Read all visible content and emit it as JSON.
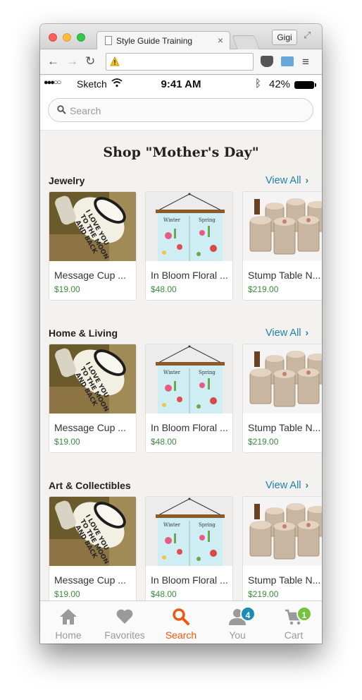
{
  "browser": {
    "tab_title": "Style Guide Training",
    "tab_close": "×",
    "profile_name": "Gigi",
    "url": ""
  },
  "statusbar": {
    "signal": "●●●○○",
    "carrier": "Sketch",
    "time": "9:41 AM",
    "battery": "42%"
  },
  "search": {
    "placeholder": "Search"
  },
  "shop": {
    "title": "Shop \"Mother's Day\""
  },
  "sections": [
    {
      "title": "Jewelry",
      "view_all": "View All",
      "items": [
        {
          "name": "Message Cup ...",
          "price": "$19.00"
        },
        {
          "name": "In Bloom Floral ...",
          "price": "$48.00"
        },
        {
          "name": "Stump Table N...",
          "price": "$219.00"
        }
      ]
    },
    {
      "title": "Home & Living",
      "view_all": "View All",
      "items": [
        {
          "name": "Message Cup ...",
          "price": "$19.00"
        },
        {
          "name": "In Bloom Floral ...",
          "price": "$48.00"
        },
        {
          "name": "Stump Table N...",
          "price": "$219.00"
        }
      ]
    },
    {
      "title": "Art & Collectibles",
      "view_all": "View All",
      "items": [
        {
          "name": "Message Cup ...",
          "price": "$19.00"
        },
        {
          "name": "In Bloom Floral ...",
          "price": "$48.00"
        },
        {
          "name": "Stump Table N...",
          "price": "$219.00"
        }
      ]
    }
  ],
  "tabbar": {
    "items": [
      {
        "label": "Home",
        "icon": "home-icon"
      },
      {
        "label": "Favorites",
        "icon": "heart-icon"
      },
      {
        "label": "Search",
        "icon": "search-icon"
      },
      {
        "label": "You",
        "icon": "person-icon",
        "badge": "4"
      },
      {
        "label": "Cart",
        "icon": "cart-icon",
        "badge": "1"
      }
    ],
    "active": "Search"
  },
  "colors": {
    "link": "#1f80ab",
    "price": "#3b8a3e",
    "active_tab": "#f0580f",
    "badge_you": "#1d8bb8",
    "badge_cart": "#74c33a"
  }
}
